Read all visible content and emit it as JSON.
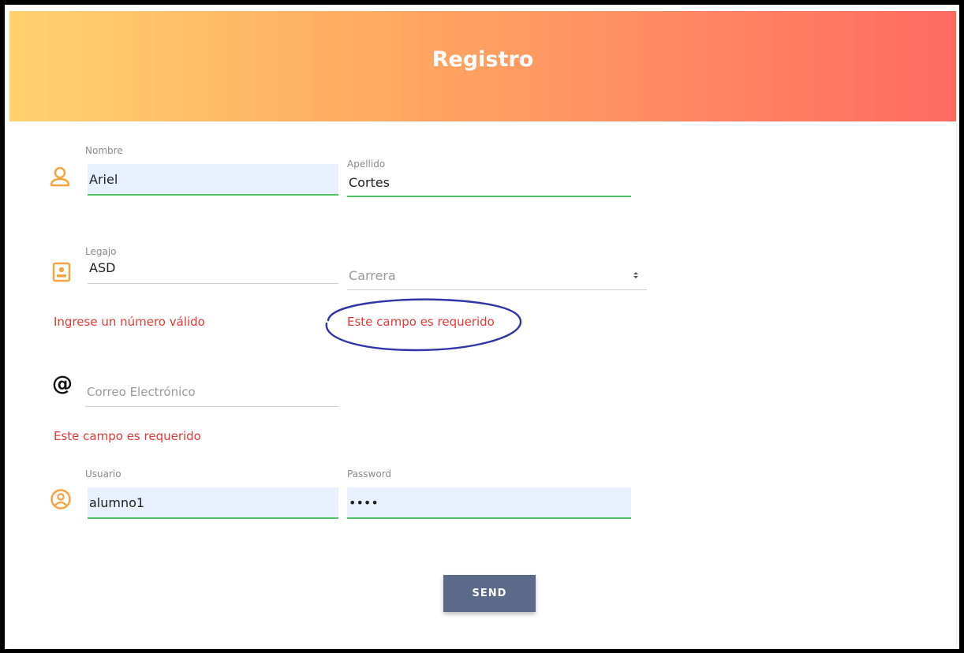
{
  "form": {
    "title": "Registro",
    "nombre": {
      "label": "Nombre",
      "value": "Ariel"
    },
    "apellido": {
      "label": "Apellido",
      "value": "Cortes"
    },
    "legajo": {
      "label": "Legajo",
      "value": "ASD",
      "error": "Ingrese un número válido"
    },
    "carrera": {
      "placeholder": "Carrera",
      "error": "Este campo es requerido"
    },
    "correo": {
      "placeholder": "Correo Electrónico",
      "error": "Este campo es requerido"
    },
    "usuario": {
      "label": "Usuario",
      "value": "alumno1"
    },
    "password": {
      "label": "Password",
      "value": "••••"
    },
    "send_label": "SEND"
  },
  "icons": {
    "user": "user-icon",
    "badge": "id-badge-icon",
    "at": "at-icon",
    "account": "account-circle-icon"
  },
  "colors": {
    "accent": "#f5a442",
    "error": "#e53935",
    "valid": "#4bc462",
    "button": "#5b6a89",
    "annotation": "#2f35a8"
  }
}
